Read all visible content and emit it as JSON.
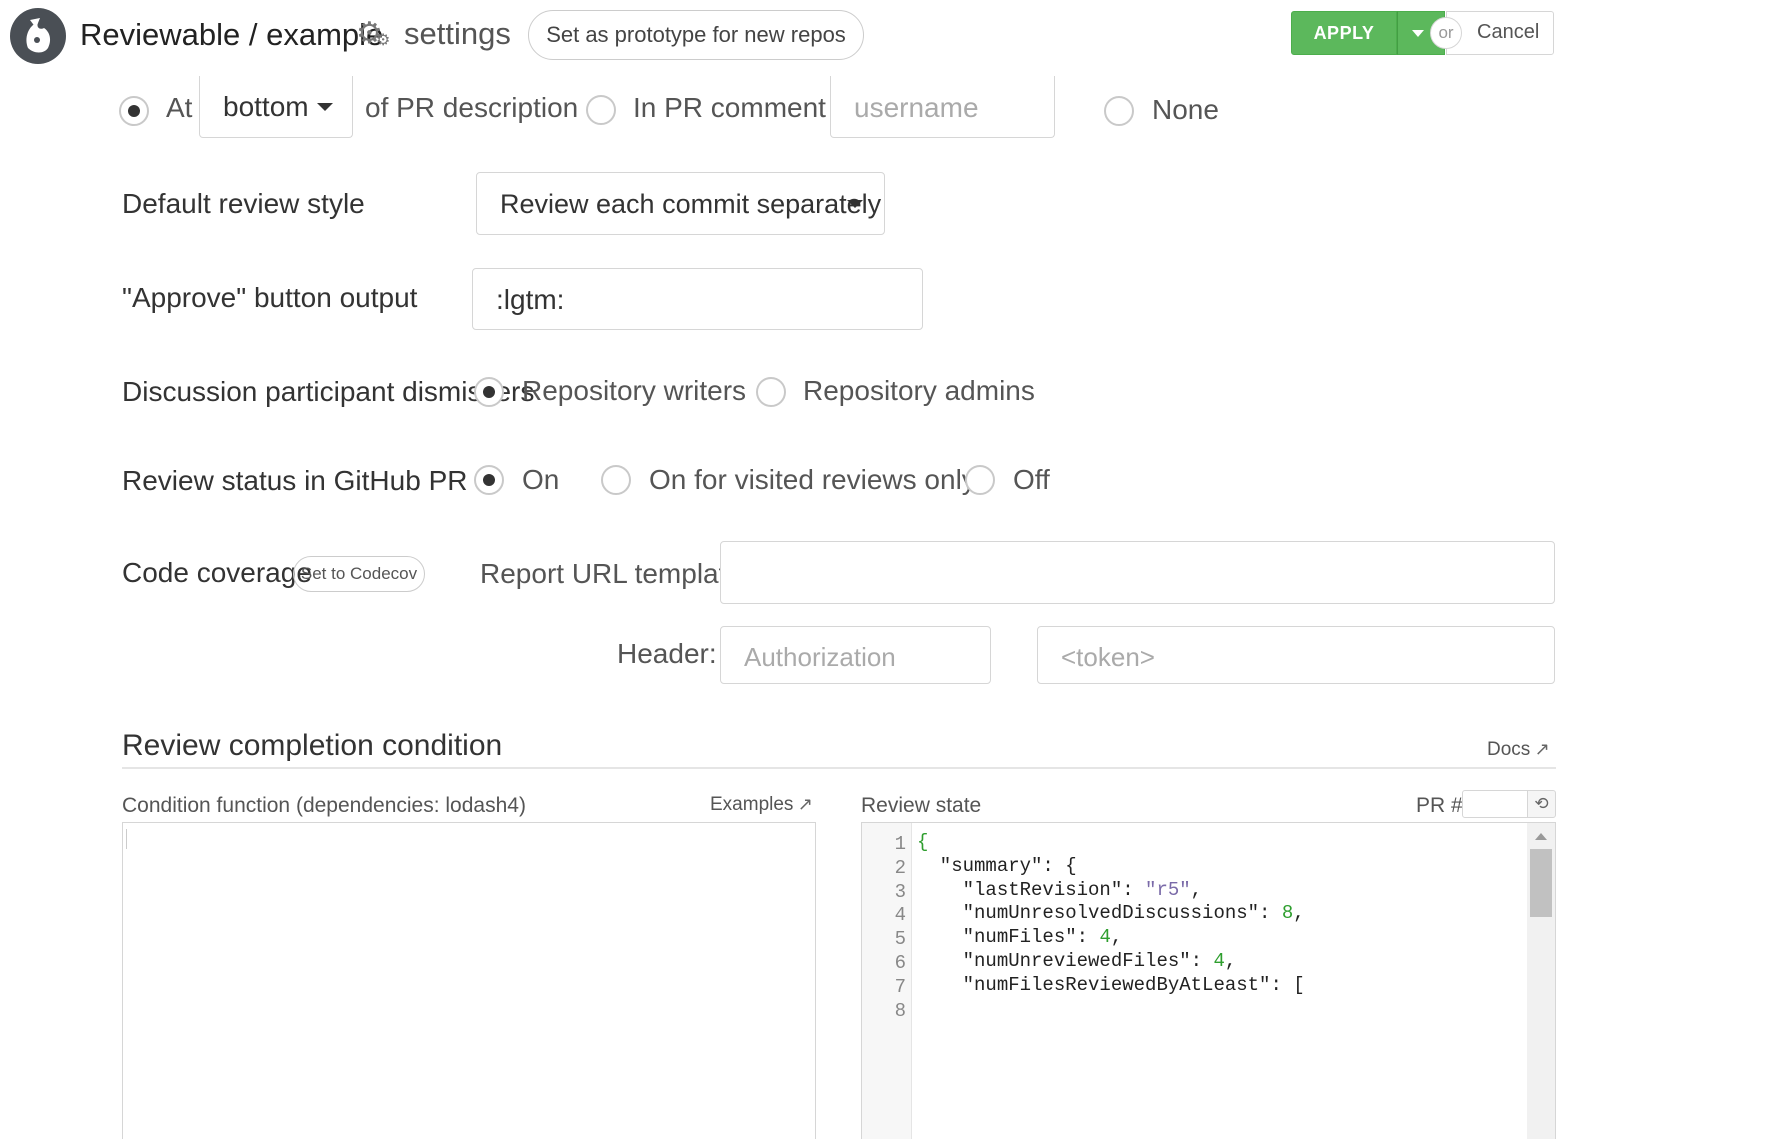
{
  "header": {
    "repo": "Reviewable / example",
    "settings": "settings",
    "prototype_button": "Set as prototype for new repos",
    "apply": "APPLY",
    "or": "or",
    "cancel": "Cancel"
  },
  "placement": {
    "at_label": "At",
    "position": "bottom",
    "description_label": "of PR description",
    "comment_label": "In PR comment by",
    "username_placeholder": "username",
    "none_label": "None",
    "selected": "at"
  },
  "review_style": {
    "label": "Default review style",
    "value": "Review each commit separately"
  },
  "approve": {
    "label": "\"Approve\" button output",
    "value": ":lgtm:"
  },
  "dismissers": {
    "label": "Discussion participant dismissers",
    "options": [
      "Repository writers",
      "Repository admins"
    ],
    "selected": "Repository writers"
  },
  "review_status": {
    "label": "Review status in GitHub PR",
    "options": [
      "On",
      "On for visited reviews only",
      "Off"
    ],
    "selected": "On"
  },
  "coverage": {
    "label": "Code coverage",
    "codecov_button": "Set to Codecov",
    "url_label": "Report URL template:",
    "url_value": "",
    "header_label": "Header:",
    "header_name_placeholder": "Authorization",
    "header_value_placeholder": "<token>"
  },
  "completion": {
    "title": "Review completion condition",
    "docs": "Docs",
    "condition_label": "Condition function (dependencies: lodash4)",
    "examples": "Examples",
    "state_label": "Review state",
    "pr_label": "PR #",
    "code_lines": [
      {
        "n": "1",
        "t": [
          {
            "c": "g",
            "s": "{"
          }
        ]
      },
      {
        "n": "2",
        "t": [
          {
            "c": "k",
            "s": "  \"summary\": {"
          }
        ]
      },
      {
        "n": "3",
        "t": [
          {
            "c": "k",
            "s": "    \"lastRevision\": "
          },
          {
            "c": "s",
            "s": "\"r5\""
          },
          {
            "c": "k",
            "s": ","
          }
        ]
      },
      {
        "n": "4",
        "t": [
          {
            "c": "k",
            "s": "    \"numUnresolvedDiscussions\": "
          },
          {
            "c": "g",
            "s": "8"
          },
          {
            "c": "k",
            "s": ","
          }
        ]
      },
      {
        "n": "5",
        "t": [
          {
            "c": "k",
            "s": "    \"numFiles\": "
          },
          {
            "c": "g",
            "s": "4"
          },
          {
            "c": "k",
            "s": ","
          }
        ]
      },
      {
        "n": "6",
        "t": [
          {
            "c": "k",
            "s": "    \"numUnreviewedFiles\": "
          },
          {
            "c": "g",
            "s": "4"
          },
          {
            "c": "k",
            "s": ","
          }
        ]
      },
      {
        "n": "7",
        "t": [
          {
            "c": "k",
            "s": "    \"numFilesReviewedByAtLeast\": ["
          }
        ]
      },
      {
        "n": "8",
        "t": []
      }
    ]
  },
  "colors": {
    "apply_green": "#5cb85c",
    "code_green": "#2e9e2e",
    "code_string": "#7a6aa8"
  }
}
